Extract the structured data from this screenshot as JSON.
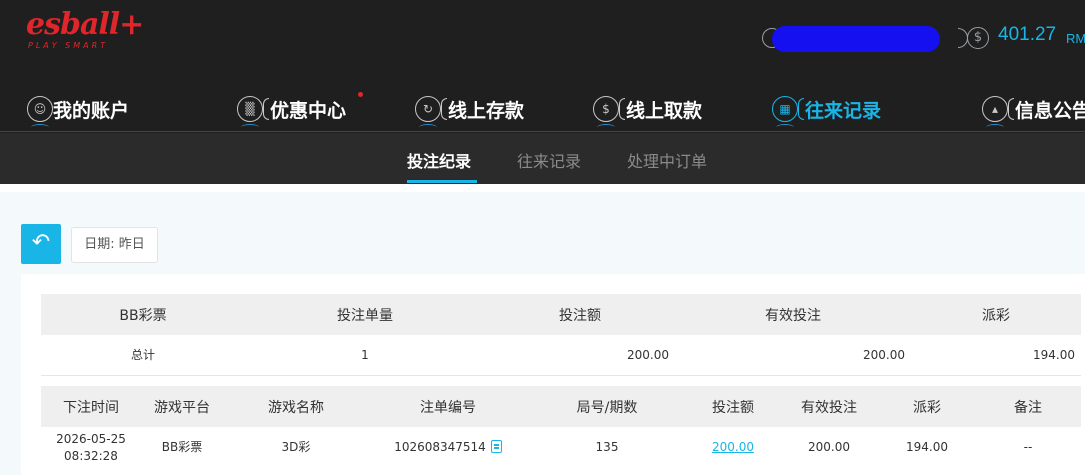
{
  "brand": {
    "logo_text": "esball+",
    "tagline": "PLAY SMART",
    "color": "#e0262b"
  },
  "account": {
    "balance": "401.27",
    "currency": "RM",
    "accent": "#19b5e6"
  },
  "main_nav": [
    {
      "label": "我的账户",
      "icon": "user-icon"
    },
    {
      "label": "优惠中心",
      "icon": "gift-icon",
      "has_dot": true
    },
    {
      "label": "线上存款",
      "icon": "deposit-icon"
    },
    {
      "label": "线上取款",
      "icon": "withdraw-icon"
    },
    {
      "label": "往来记录",
      "icon": "records-icon",
      "active": true
    },
    {
      "label": "信息公告",
      "icon": "bell-icon"
    }
  ],
  "sub_tabs": [
    {
      "label": "投注纪录",
      "active": true
    },
    {
      "label": "往来记录"
    },
    {
      "label": "处理中订单"
    }
  ],
  "filter": {
    "date_label": "日期: 昨日",
    "back_icon": "back-arrow-icon"
  },
  "summary": {
    "headers": [
      "BB彩票",
      "投注单量",
      "投注额",
      "有效投注",
      "派彩"
    ],
    "row": [
      "总计",
      "1",
      "200.00",
      "200.00",
      "194.00"
    ]
  },
  "detail": {
    "headers": [
      "下注时间",
      "游戏平台",
      "游戏名称",
      "注单编号",
      "局号/期数",
      "投注额",
      "有效投注",
      "派彩",
      "备注"
    ],
    "rows": [
      {
        "date": "2026-05-25",
        "time": "08:32:28",
        "platform": "BB彩票",
        "game": "3D彩",
        "bet_id": "102608347514",
        "round": "135",
        "amount": "200.00",
        "valid": "200.00",
        "payout": "194.00",
        "note": "--"
      }
    ]
  }
}
